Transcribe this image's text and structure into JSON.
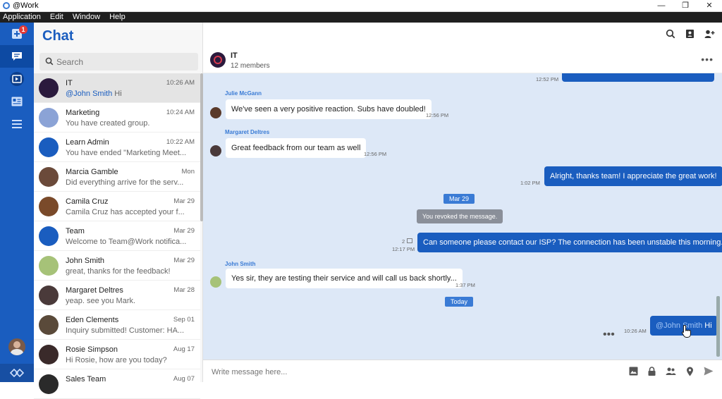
{
  "window": {
    "title": "@Work",
    "minimize": "—",
    "restore": "❐",
    "close": "✕"
  },
  "menu": [
    "Application",
    "Edit",
    "Window",
    "Help"
  ],
  "rail": {
    "badge": "1",
    "icons": [
      "add-icon",
      "chat-icon",
      "media-icon",
      "contacts-icon",
      "menu-icon",
      "profile-avatar",
      "logo-icon"
    ]
  },
  "list": {
    "title": "Chat",
    "search_placeholder": "Search",
    "conversations": [
      {
        "name": "IT",
        "time": "10:26 AM",
        "mention": "@John Smith",
        "preview": " Hi",
        "avatar_color": "#2b1a3d"
      },
      {
        "name": "Marketing",
        "time": "10:24 AM",
        "mention": "",
        "preview": "You have created group.",
        "avatar_color": "#8ba3d6"
      },
      {
        "name": "Learn Admin",
        "time": "10:22 AM",
        "mention": "",
        "preview": "You have ended \"Marketing Meet...",
        "avatar_color": "#1a5dbf"
      },
      {
        "name": "Marcia Gamble",
        "time": "Mon",
        "mention": "",
        "preview": "Did everything arrive for the serv...",
        "avatar_color": "#6b4a3a"
      },
      {
        "name": "Camila Cruz",
        "time": "Mar 29",
        "mention": "",
        "preview": "Camila Cruz has accepted your f...",
        "avatar_color": "#7a4a2a"
      },
      {
        "name": "Team",
        "time": "Mar 29",
        "mention": "",
        "preview": "Welcome to Team@Work notifica...",
        "avatar_color": "#1a5dbf"
      },
      {
        "name": "John Smith",
        "time": "Mar 29",
        "mention": "",
        "preview": "great, thanks for the feedback!",
        "avatar_color": "#a6c278"
      },
      {
        "name": "Margaret Deltres",
        "time": "Mar 28",
        "mention": "",
        "preview": "yeap. see you Mark.",
        "avatar_color": "#4a3a3a"
      },
      {
        "name": "Eden Clements",
        "time": "Sep 01",
        "mention": "",
        "preview": "Inquiry submitted! Customer: HA...",
        "avatar_color": "#5a4a3a"
      },
      {
        "name": "Rosie Simpson",
        "time": "Aug 17",
        "mention": "",
        "preview": "Hi Rosie, how are you today?",
        "avatar_color": "#3a2a2a"
      },
      {
        "name": "Sales Team",
        "time": "Aug 07",
        "mention": "",
        "preview": "",
        "avatar_color": "#2a2a2a"
      }
    ]
  },
  "header": {
    "icons": [
      "search-icon",
      "contacts-book-icon",
      "add-user-icon"
    ]
  },
  "conversation": {
    "name": "IT",
    "members": "12 members",
    "more": "•••"
  },
  "messages": {
    "top_time": "12:52 PM",
    "m1": {
      "sender": "Julie McGann",
      "text": "We've seen a very positive reaction. Subs have doubled!",
      "time": "12:56 PM"
    },
    "m2": {
      "sender": "Margaret Deltres",
      "text": "Great feedback from our team as well",
      "time": "12:56 PM"
    },
    "m3": {
      "text": "Alright, thanks team! I appreciate the great work!",
      "time": "1:02 PM"
    },
    "date1": "Mar 29",
    "revoked": "You revoked the message.",
    "m4": {
      "text": "Can someone please contact our ISP? The connection has been unstable this morning.",
      "time": "12:17 PM",
      "reads": "2"
    },
    "m5": {
      "sender": "John Smith",
      "text": "Yes sir, they are testing their service and will call us back shortly...",
      "time": "1:37 PM"
    },
    "date2": "Today",
    "m6": {
      "mention": "@John Smith",
      "text": " Hi",
      "time": "10:26 AM",
      "typing": "•••"
    }
  },
  "composer": {
    "placeholder": "Write message here..."
  },
  "colors": {
    "brand": "#1a5dbf",
    "rail": "#1a5dbf",
    "chat_bg": "#dde8f7"
  }
}
